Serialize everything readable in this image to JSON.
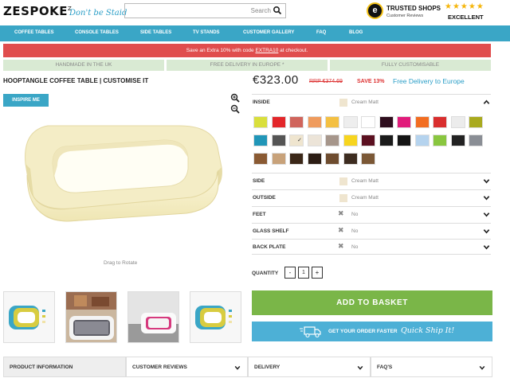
{
  "header": {
    "logo": "ZESPOKE",
    "logo_mark": "Z",
    "tagline": "Don't be Staid",
    "search_placeholder": "Search",
    "trust_badge_letter": "e",
    "trust_title": "TRUSTED SHOPS",
    "trust_subtitle": "Customer Reviews",
    "stars": "★★★★★",
    "rating": "EXCELLENT"
  },
  "nav": [
    "COFFEE TABLES",
    "CONSOLE TABLES",
    "SIDE TABLES",
    "TV STANDS",
    "CUSTOMER GALLERY",
    "FAQ",
    "BLOG"
  ],
  "promo": {
    "before": "Save an Extra 10% with code ",
    "code": "EXTRA10",
    "after": " at checkout."
  },
  "usps": [
    "HANDMADE IN THE UK",
    "FREE DELIVERY IN EUROPE *",
    "FULLY CUSTOMISABLE"
  ],
  "product": {
    "title": "HOOPTANGLE COFFEE TABLE | CUSTOMISE IT",
    "inspire_label": "INSPIRE ME",
    "drag_hint": "Drag to Rotate",
    "price": "€323.00",
    "rrp": "RRP €374.69",
    "save": "SAVE 13%",
    "delivery": "Free Delivery to Europe"
  },
  "options": {
    "inside": {
      "label": "INSIDE",
      "value": "Cream Matt"
    },
    "side": {
      "label": "SIDE",
      "value": "Cream Matt"
    },
    "outside": {
      "label": "OUTSIDE",
      "value": "Cream Matt"
    },
    "feet": {
      "label": "FEET",
      "value": "No"
    },
    "glass_shelf": {
      "label": "GLASS SHELF",
      "value": "No"
    },
    "back_plate": {
      "label": "BACK PLATE",
      "value": "No"
    }
  },
  "swatch_colors": [
    [
      "#d9df3c",
      "#e3262a",
      "#d0655c",
      "#ef9b5d",
      "#f4c042",
      "#eeeeee",
      "#ffffff",
      "#2f0e1e",
      "#e11b7b",
      "#f26d21",
      "#d92e2e",
      "#ececec",
      "#a9aa1e"
    ],
    [
      "#2196b8",
      "#555555",
      "#efe5cf",
      "#ece4d8",
      "#a6968b",
      "#f7d51f",
      "#5b1020",
      "#1b1b1b",
      "#141414",
      "#b5d3ee",
      "#89c63f",
      "#222222",
      "#8a8e95"
    ],
    [
      "#8a5a33",
      "#c8a27a",
      "#3b2718",
      "#2c1d14",
      "#6e4c2f",
      "#3d2c20",
      "#7b5836"
    ]
  ],
  "selected_swatch": "Cream Matt",
  "quantity": {
    "label": "QUANTITY",
    "value": "1",
    "minus": "-",
    "plus": "+"
  },
  "basket_label": "ADD TO BASKET",
  "quick": {
    "text": "GET YOUR ORDER FASTER",
    "script": "Quick Ship It!"
  },
  "tabs": [
    "PRODUCT INFORMATION",
    "CUSTOMER REVIEWS",
    "DELIVERY",
    "FAQ'S"
  ],
  "accent": "#3aa6c6",
  "brand_green": "#7ab648",
  "alert_red": "#e04d4d"
}
